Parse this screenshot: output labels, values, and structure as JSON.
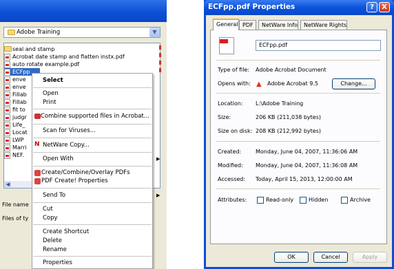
{
  "file_dialog": {
    "folder": "Adobe Training",
    "files": [
      {
        "name": "seal and stamp",
        "type": "folder"
      },
      {
        "name": "Acrobat date stamp and flatten instx.pdf",
        "type": "pdf"
      },
      {
        "name": "auto rotate example.pdf",
        "type": "pdf"
      },
      {
        "name": "ECFpp",
        "type": "pdf",
        "selected": true
      },
      {
        "name": "enve",
        "type": "pdf"
      },
      {
        "name": "enve",
        "type": "pdf"
      },
      {
        "name": "Fillab",
        "type": "pdf"
      },
      {
        "name": "Fillab",
        "type": "pdf"
      },
      {
        "name": "fit to",
        "type": "pdf"
      },
      {
        "name": "judgr",
        "type": "pdf"
      },
      {
        "name": "Life_",
        "type": "pdf"
      },
      {
        "name": "Locat",
        "type": "pdf"
      },
      {
        "name": "LWP",
        "type": "pdf"
      },
      {
        "name": "Marri",
        "type": "pdf"
      },
      {
        "name": "NEF.",
        "type": "pdf"
      }
    ],
    "file_name_label": "File name",
    "files_of_type_label": "Files of ty"
  },
  "context_menu": {
    "items": [
      {
        "label": "Select",
        "bold": true
      },
      {
        "label": "Open"
      },
      {
        "label": "Print"
      },
      {
        "label": "Combine supported files in Acrobat..."
      },
      {
        "label": "Scan for Viruses..."
      },
      {
        "label": "NetWare Copy..."
      },
      {
        "label": "Open With",
        "submenu": true
      },
      {
        "label": "Create/Combine/Overlay PDFs"
      },
      {
        "label": "PDF Create! Properties"
      },
      {
        "label": "Send To",
        "submenu": true
      },
      {
        "label": "Cut"
      },
      {
        "label": "Copy"
      },
      {
        "label": "Create Shortcut"
      },
      {
        "label": "Delete"
      },
      {
        "label": "Rename"
      },
      {
        "label": "Properties"
      }
    ]
  },
  "properties": {
    "title": "ECFpp.pdf Properties",
    "tabs": [
      "General",
      "PDF",
      "NetWare Info",
      "NetWare Rights"
    ],
    "file_name": "ECFpp.pdf",
    "type_label": "Type of file:",
    "type_value": "Adobe Acrobat Document",
    "opens_label": "Opens with:",
    "opens_value": "Adobe Acrobat 9.5",
    "change_button": "Change...",
    "location_label": "Location:",
    "location_value": "L:\\Adobe Training",
    "size_label": "Size:",
    "size_value": "206 KB (211,038 bytes)",
    "size_disk_label": "Size on disk:",
    "size_disk_value": "208 KB (212,992 bytes)",
    "created_label": "Created:",
    "created_value": "Monday, June 04, 2007, 11:36:06 AM",
    "modified_label": "Modified:",
    "modified_value": "Monday, June 04, 2007, 11:36:08 AM",
    "accessed_label": "Accessed:",
    "accessed_value": "Today, April 15, 2013, 12:00:00 AM",
    "attributes_label": "Attributes:",
    "attributes": [
      "Read-only",
      "Hidden",
      "Archive"
    ],
    "ok_button": "OK",
    "cancel_button": "Cancel",
    "apply_button": "Apply",
    "help_button": "?",
    "close_button": "X"
  },
  "colors": {
    "titlebar": "#0a4fd6",
    "selection": "#316ac5",
    "tab_accent": "#f3a94a"
  }
}
